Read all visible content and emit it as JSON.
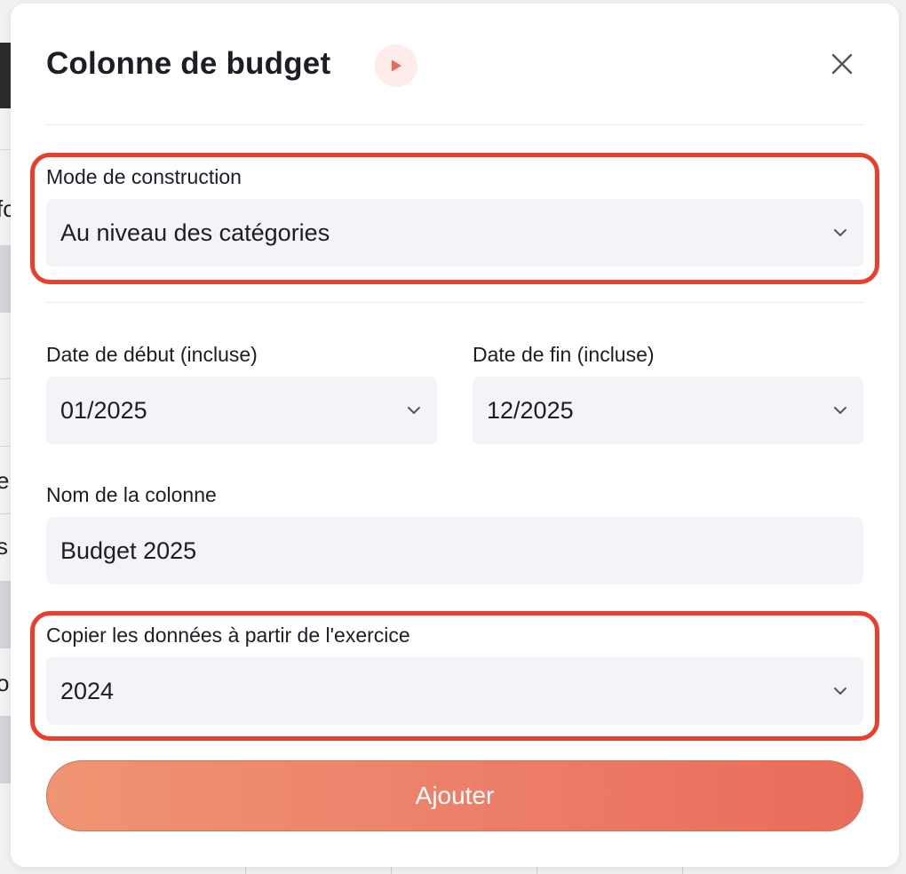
{
  "modal": {
    "title": "Colonne de budget",
    "close_icon": "close-icon",
    "play_icon": "play-icon"
  },
  "form": {
    "mode": {
      "label": "Mode de construction",
      "value": "Au niveau des catégories"
    },
    "start_date": {
      "label": "Date de début (incluse)",
      "value": "01/2025"
    },
    "end_date": {
      "label": "Date de fin (incluse)",
      "value": "12/2025"
    },
    "column_name": {
      "label": "Nom de la colonne",
      "value": "Budget 2025"
    },
    "copy_from": {
      "label": "Copier les données à partir de l'exercice",
      "value": "2024"
    },
    "submit_label": "Ajouter"
  },
  "background": {
    "partial_chars": [
      "fc",
      "e",
      "s",
      "o"
    ]
  },
  "colors": {
    "highlight": "#e8402d",
    "accent_gradient_start": "#ef9572",
    "accent_gradient_end": "#e96c5a",
    "field_bg": "#f3f4f8"
  }
}
